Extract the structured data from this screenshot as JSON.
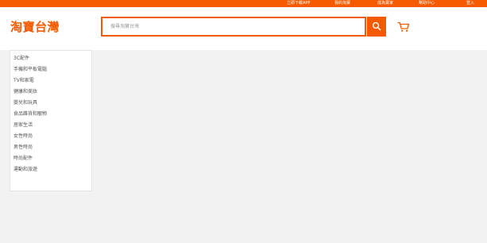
{
  "topbar": {
    "links": [
      "立即下載APP",
      "我的淘寶",
      "成為賣家",
      "幫助中心",
      "登入"
    ]
  },
  "header": {
    "logo": "淘寶台灣"
  },
  "search": {
    "placeholder": "搜尋淘寶台灣"
  },
  "categories": [
    "3C配件",
    "手機和平板電腦",
    "TV和家電",
    "健康和美妝",
    "嬰兒和玩具",
    "食品雜貨和寵物",
    "居家生活",
    "女性時尚",
    "男性時尚",
    "時尚配件",
    "運動和旅遊"
  ],
  "colors": {
    "brand": "#f55a00",
    "background": "#f2f2f2"
  },
  "icons": {
    "search": "search-icon",
    "cart": "cart-icon"
  }
}
